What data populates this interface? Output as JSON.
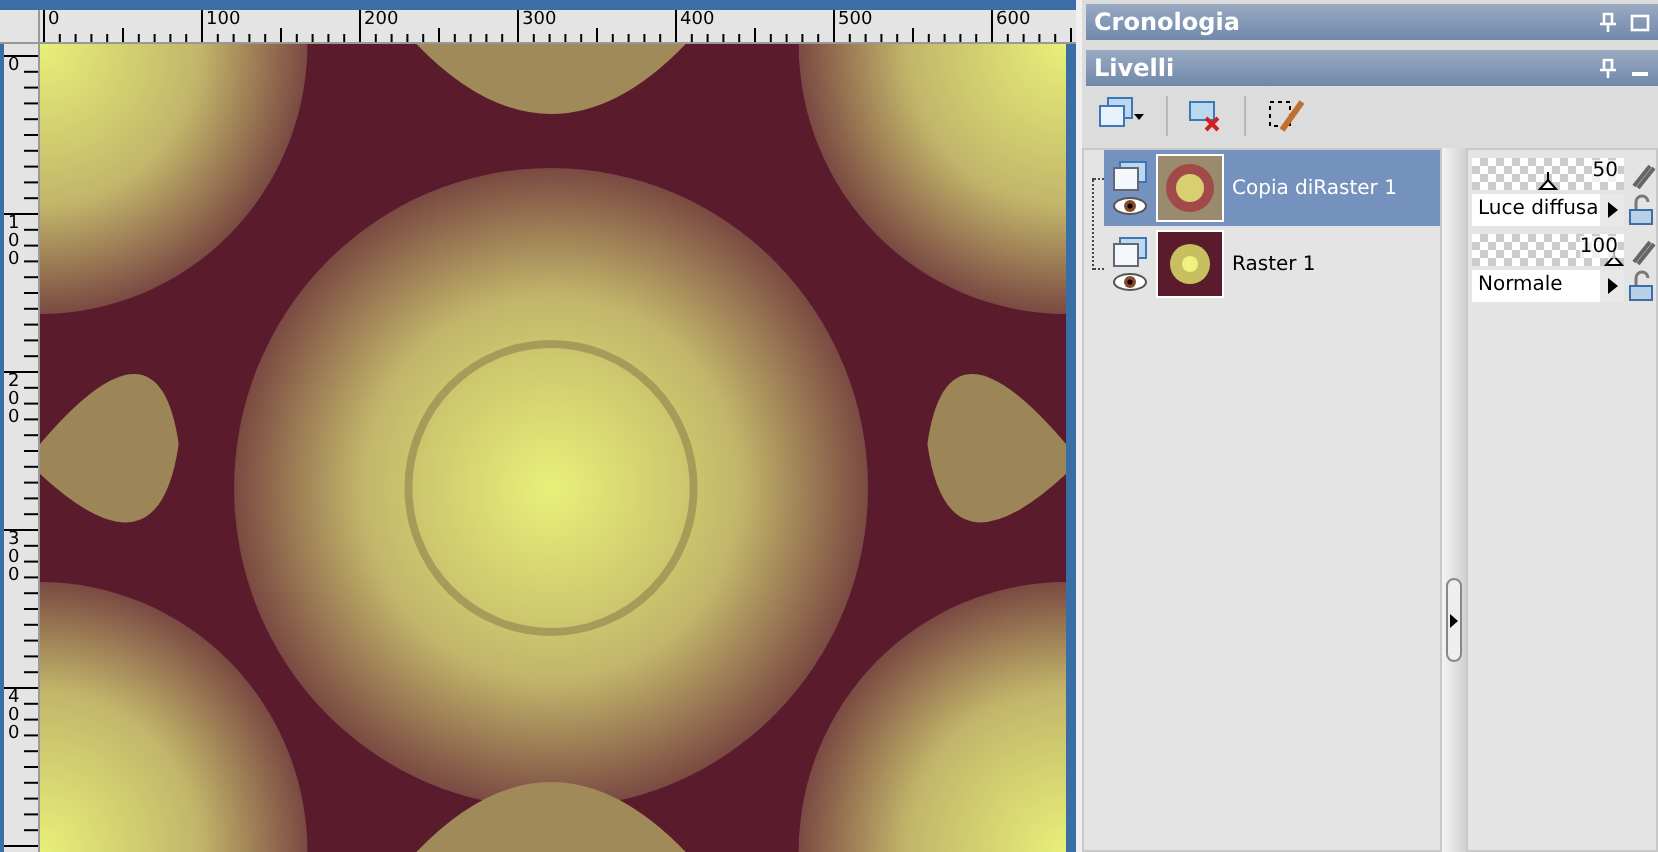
{
  "rulers": {
    "horizontal": [
      "0",
      "100",
      "200",
      "300",
      "400",
      "500",
      "600"
    ],
    "vertical": [
      "0",
      "100",
      "200",
      "300",
      "400"
    ]
  },
  "history_panel": {
    "title": "Cronologia"
  },
  "layers_panel": {
    "title": "Livelli",
    "layers": [
      {
        "name": "Copia diRaster 1",
        "selected": true,
        "opacity": "50",
        "level": 0.5,
        "blend_mode": "Luce diffusa"
      },
      {
        "name": "Raster 1",
        "selected": false,
        "opacity": "100",
        "level": 1,
        "blend_mode": "Normale"
      }
    ]
  }
}
